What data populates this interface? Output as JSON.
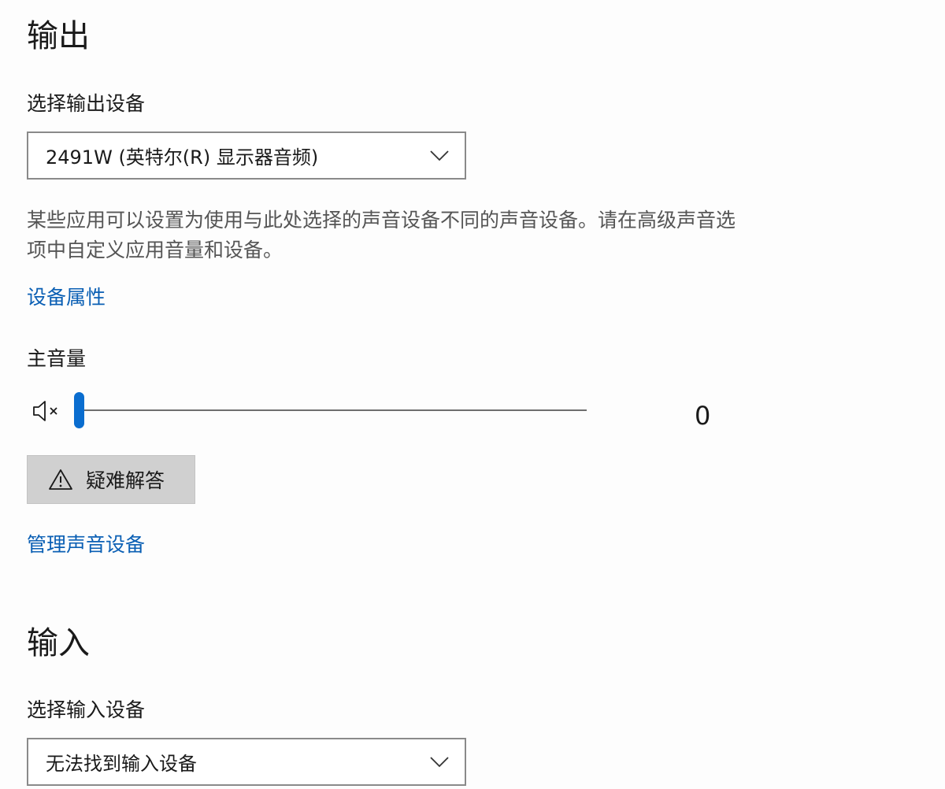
{
  "output": {
    "title": "输出",
    "select_label": "选择输出设备",
    "selected_device": "2491W (英特尔(R) 显示器音频)",
    "description": "某些应用可以设置为使用与此处选择的声音设备不同的声音设备。请在高级声音选项中自定义应用音量和设备。",
    "device_properties_link": "设备属性",
    "master_volume_label": "主音量",
    "volume_value": "0",
    "volume_level": 0,
    "volume_icon": "speaker-muted-icon",
    "troubleshoot_label": "疑难解答",
    "troubleshoot_icon": "warning-icon",
    "manage_devices_link": "管理声音设备"
  },
  "input": {
    "title": "输入",
    "select_label": "选择输入设备",
    "selected_device": "无法找到输入设备"
  },
  "colors": {
    "link": "#0a5fb4",
    "accent": "#0a6dcf",
    "button_bg": "#d0d0d0"
  }
}
